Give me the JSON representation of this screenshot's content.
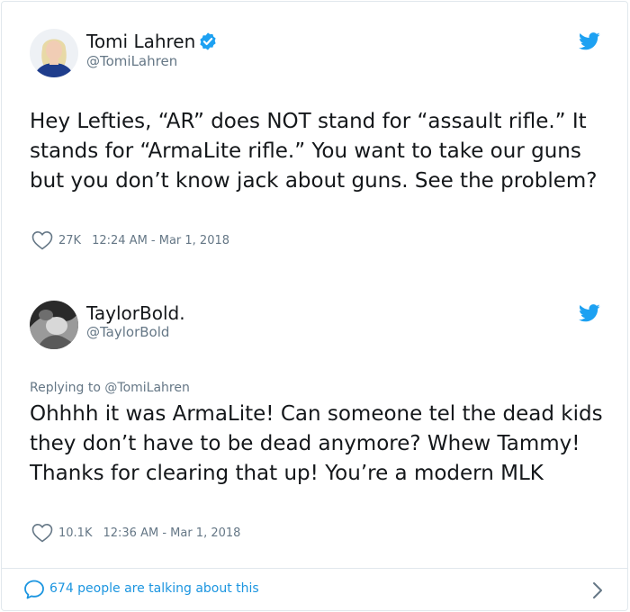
{
  "tweets": [
    {
      "name": "Tomi Lahren",
      "verified": true,
      "handle": "@TomiLahren",
      "text": "Hey Lefties, “AR” does NOT stand for “assault rifle.” It stands for “ArmaLite rifle.” You want to take our guns but you don’t know jack about guns. See the problem?",
      "likes": "27K",
      "timestamp": "12:24 AM - Mar 1, 2018"
    },
    {
      "name": "TaylorBold.",
      "verified": false,
      "handle": "@TaylorBold",
      "replying_label": "Replying to",
      "replying_to": "@TomiLahren",
      "text": "Ohhhh it was ArmaLite! Can someone tel the dead kids they don’t have to be dead anymore? Whew Tammy! Thanks for clearing that up! You’re a modern MLK",
      "likes": "10.1K",
      "timestamp": "12:36 AM - Mar 1, 2018"
    }
  ],
  "footer": {
    "text": "674 people are talking about this"
  },
  "colors": {
    "twitter_blue": "#1da1f2",
    "link_blue": "#1b95e0",
    "gray": "#657786",
    "border": "#e1e8ed"
  },
  "icons": [
    "twitter-bird-icon",
    "verified-badge-icon",
    "heart-icon",
    "speech-bubble-icon",
    "chevron-right-icon"
  ]
}
